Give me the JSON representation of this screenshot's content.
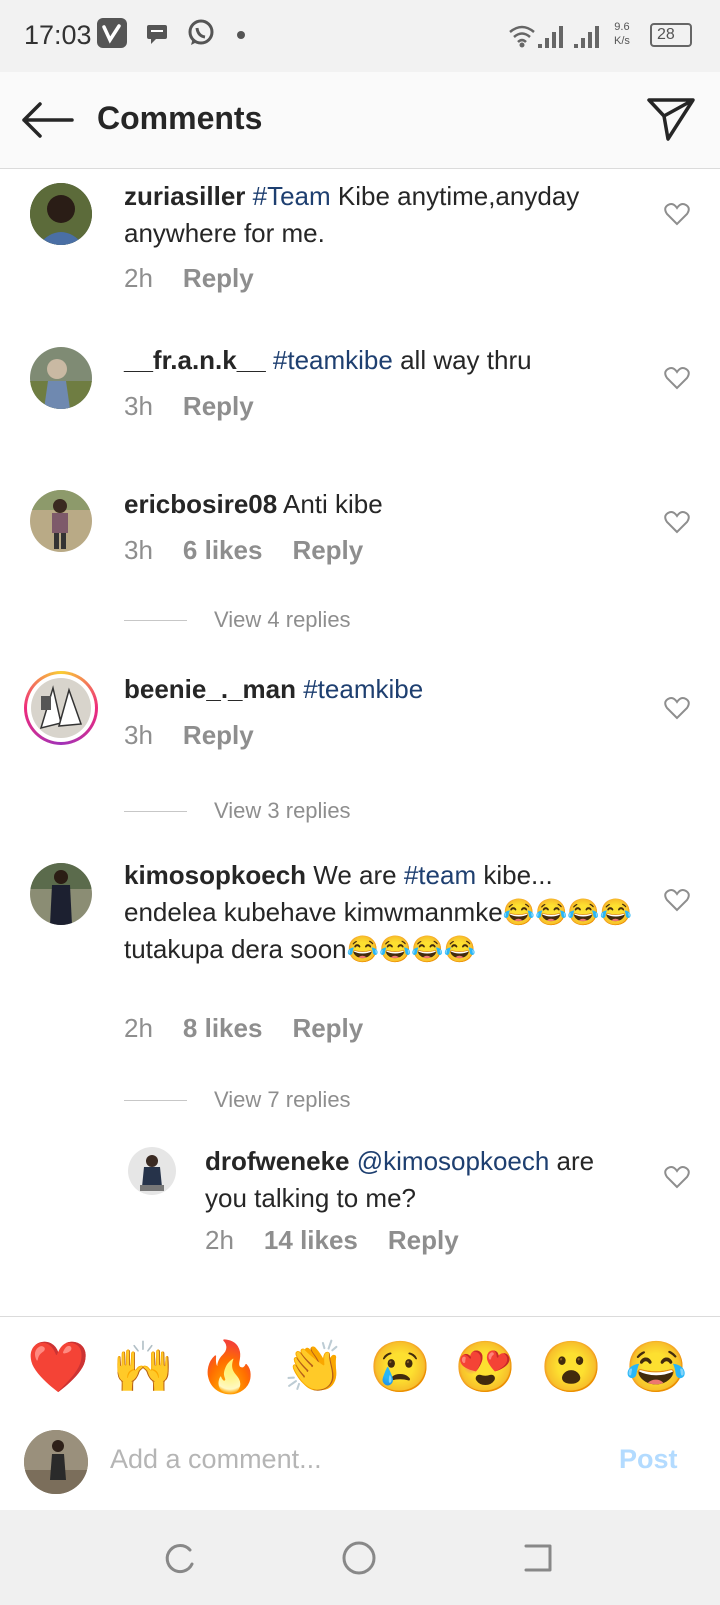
{
  "status_bar": {
    "time": "17:03",
    "speed_value": "9.6",
    "speed_unit": "K/s",
    "battery": "28",
    "icons": [
      "vimeo-icon",
      "message-icon",
      "whatsapp-icon",
      "dot-icon",
      "wifi-icon",
      "signal-icon",
      "signal-icon",
      "battery-icon"
    ]
  },
  "header": {
    "title": "Comments",
    "back_icon": "arrow-left-icon",
    "share_icon": "send-icon"
  },
  "comments": [
    {
      "username": "zuriasiller",
      "tag": "#Team",
      "text_after": " Kibe anytime,anyday anywhere for me.",
      "time": "2h",
      "likes": "",
      "reply": "Reply"
    },
    {
      "username": "__fr.a.n.k__",
      "tag": "#teamkibe",
      "text_after": " all way thru",
      "time": "3h",
      "likes": "",
      "reply": "Reply"
    },
    {
      "username": "ericbosire08",
      "tag": "",
      "text_after": " Anti kibe",
      "time": "3h",
      "likes": "6 likes",
      "reply": "Reply",
      "view_replies": "View 4 replies"
    },
    {
      "username": "beenie_._man",
      "tag": "#teamkibe",
      "text_after": "",
      "time": "3h",
      "likes": "",
      "reply": "Reply",
      "view_replies": "View 3 replies"
    },
    {
      "username": "kimosopkoech",
      "text_before": " We are ",
      "tag": "#team",
      "text_after": " kibe... endelea kubehave kimwmanmke😂😂😂😂 tutakupa dera soon😂😂😂😂",
      "time": "2h",
      "likes": "8 likes",
      "reply": "Reply",
      "view_replies": "View 7 replies"
    },
    {
      "username": "drofweneke",
      "tag": "@kimosopkoech",
      "text_after": " are you talking to me?",
      "time": "2h",
      "likes": "14 likes",
      "reply": "Reply"
    }
  ],
  "emoji_bar": [
    "❤️",
    "🙌",
    "🔥",
    "👏",
    "😢",
    "😍",
    "😮",
    "😂"
  ],
  "composer": {
    "placeholder": "Add a comment...",
    "post_label": "Post"
  },
  "nav_bar": {
    "icons": [
      "recents-icon",
      "home-icon",
      "back-icon"
    ]
  }
}
